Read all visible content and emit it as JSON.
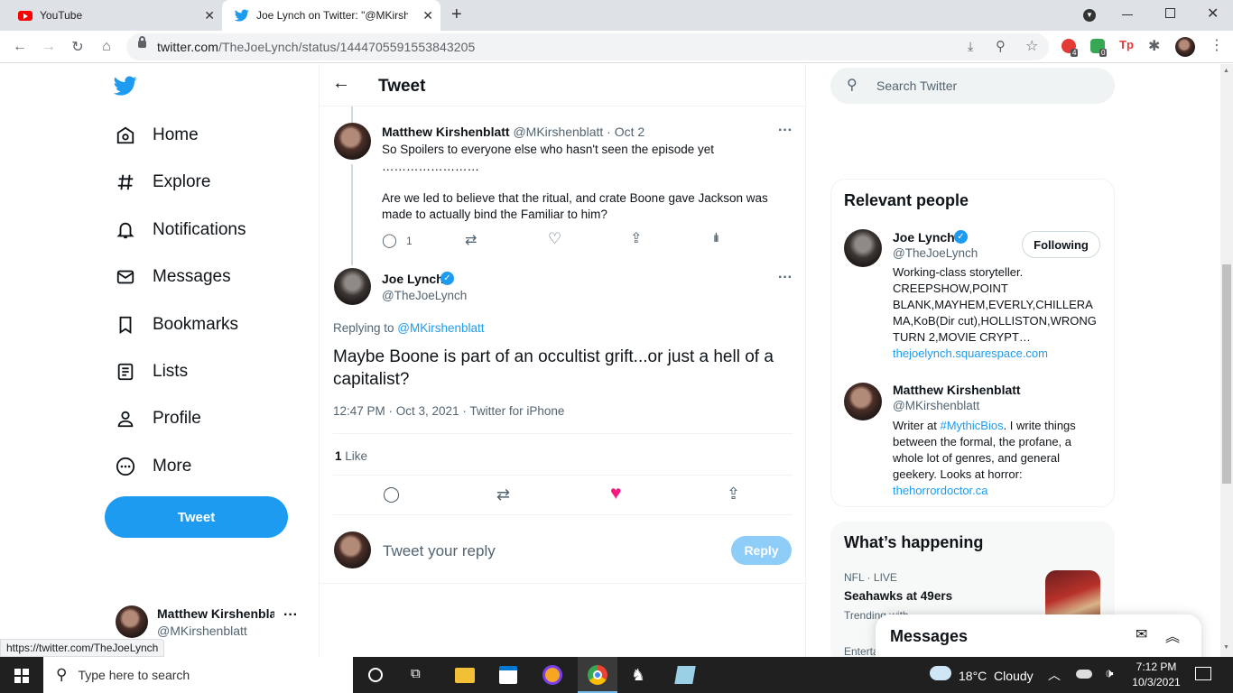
{
  "browser": {
    "tabs": [
      {
        "title": "YouTube",
        "active": false
      },
      {
        "title": "Joe Lynch on Twitter: \"@MKirshenblatt",
        "active": true
      }
    ],
    "url_domain": "twitter.com",
    "url_path": "/TheJoeLynch/status/1444705591553843205",
    "ext_badges": [
      "4",
      "0"
    ],
    "status_url": "https://twitter.com/TheJoeLynch"
  },
  "nav": {
    "items": [
      "Home",
      "Explore",
      "Notifications",
      "Messages",
      "Bookmarks",
      "Lists",
      "Profile",
      "More"
    ],
    "tweet_label": "Tweet",
    "account": {
      "name": "Matthew Kirshenblat",
      "handle": "@MKirshenblatt"
    }
  },
  "main": {
    "header_title": "Tweet",
    "parent": {
      "name": "Matthew Kirshenblatt",
      "meta": "@MKirshenblatt · Oct 2",
      "line1": "So Spoilers to everyone else who hasn't seen the episode yet",
      "line2": "……………………",
      "line3": "Are we led to believe that the ritual, and crate Boone gave Jackson was",
      "line4": "made to actually bind the Familiar to him?",
      "reply_count": "1"
    },
    "focal": {
      "name": "Joe Lynch",
      "handle": "@TheJoeLynch",
      "replying_prefix": "Replying to ",
      "replying_handle": "@MKirshenblatt",
      "text": "Maybe Boone is part of an occultist grift...or just a hell of a capitalist?",
      "timestamp": "12:47 PM · Oct 3, 2021 · Twitter for iPhone",
      "like_count": "1",
      "like_label": " Like"
    },
    "reply_box": {
      "placeholder": "Tweet your reply",
      "button": "Reply"
    }
  },
  "right": {
    "search_placeholder": "Search Twitter",
    "relevant_title": "Relevant people",
    "people": [
      {
        "name": "Joe Lynch",
        "handle": "@TheJoeLynch",
        "button": "Following",
        "bio": [
          "Working-class storyteller.",
          "CREEPSHOW,POINT",
          "BLANK,MAYHEM,EVERLY,CHILLERA",
          "MA,KoB(Dir cut),HOLLISTON,WRONG",
          "TURN 2,MOVIE CRYPT…"
        ],
        "link": "thejoelynch.squarespace.com"
      },
      {
        "name": "Matthew Kirshenblatt",
        "handle": "@MKirshenblatt",
        "bio_pre": "Writer at ",
        "bio_tag": "#MythicBios",
        "bio_post": ". I write things",
        "bio": [
          "between the formal, the profane, a",
          "whole lot of genres, and general",
          "geekery. Looks at horror:"
        ],
        "link": "thehorrordoctor.ca"
      }
    ],
    "happening_title": "What’s happening",
    "trend": {
      "meta": "NFL · LIVE",
      "title": "Seahawks at 49ers",
      "sub": "Trending with",
      "next": "Enterta"
    },
    "messages_label": "Messages"
  },
  "taskbar": {
    "search_placeholder": "Type here to search",
    "weather": "18°C  Cloudy",
    "time": "7:12 PM",
    "date": "10/3/2021"
  }
}
